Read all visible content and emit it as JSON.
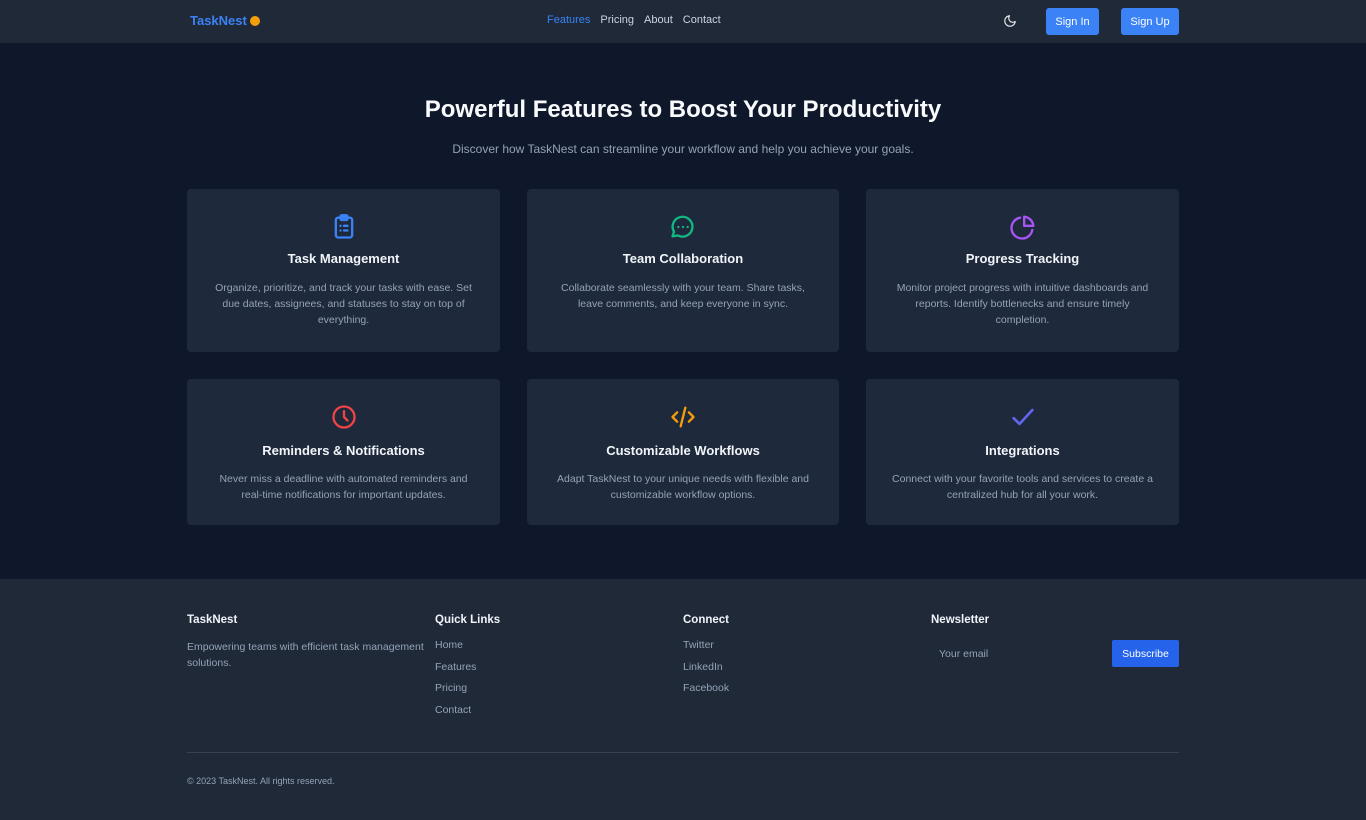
{
  "nav": {
    "brand": "TaskNest",
    "links": [
      {
        "label": "Features",
        "active": true
      },
      {
        "label": "Pricing",
        "active": false
      },
      {
        "label": "About",
        "active": false
      },
      {
        "label": "Contact",
        "active": false
      }
    ],
    "sign_in": "Sign In",
    "sign_up": "Sign Up"
  },
  "hero": {
    "title": "Powerful Features to Boost Your Productivity",
    "subtitle": "Discover how TaskNest can streamline your workflow and help you achieve your goals."
  },
  "features": [
    {
      "icon": "clipboard-icon",
      "color": "#3b82f6",
      "title": "Task Management",
      "desc": "Organize, prioritize, and track your tasks with ease. Set due dates, assignees, and statuses to stay on top of everything."
    },
    {
      "icon": "chat-icon",
      "color": "#10b981",
      "title": "Team Collaboration",
      "desc": "Collaborate seamlessly with your team. Share tasks, leave comments, and keep everyone in sync."
    },
    {
      "icon": "pie-chart-icon",
      "color": "#a855f7",
      "title": "Progress Tracking",
      "desc": "Monitor project progress with intuitive dashboards and reports. Identify bottlenecks and ensure timely completion."
    },
    {
      "icon": "clock-icon",
      "color": "#ef4444",
      "title": "Reminders & Notifications",
      "desc": "Never miss a deadline with automated reminders and real-time notifications for important updates."
    },
    {
      "icon": "code-icon",
      "color": "#f59e0b",
      "title": "Customizable Workflows",
      "desc": "Adapt TaskNest to your unique needs with flexible and customizable workflow options."
    },
    {
      "icon": "check-icon",
      "color": "#6366f1",
      "title": "Integrations",
      "desc": "Connect with your favorite tools and services to create a centralized hub for all your work."
    }
  ],
  "footer": {
    "about_title": "TaskNest",
    "about_text": "Empowering teams with efficient task management solutions.",
    "quick_title": "Quick Links",
    "quick_links": [
      "Home",
      "Features",
      "Pricing",
      "Contact"
    ],
    "connect_title": "Connect",
    "connect_links": [
      "Twitter",
      "LinkedIn",
      "Facebook"
    ],
    "newsletter_title": "Newsletter",
    "email_placeholder": "Your email",
    "subscribe": "Subscribe",
    "copyright": "© 2023 TaskNest. All rights reserved."
  },
  "colors": {
    "accent": "#3b82f6",
    "background": "#0f172a",
    "card": "#1e293b",
    "header": "#1f2937"
  }
}
